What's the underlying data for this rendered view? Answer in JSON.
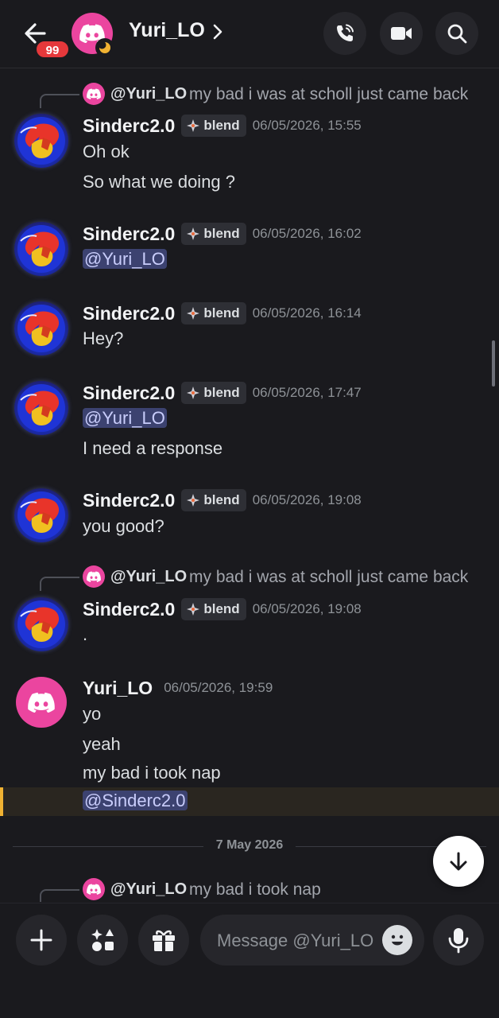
{
  "header": {
    "title": "Yuri_LO",
    "badge_count": "99",
    "back_icon": "arrow-left-icon",
    "actions": [
      "phone-call-icon",
      "video-camera-icon",
      "search-icon"
    ]
  },
  "messages": [
    {
      "reply": {
        "name": "@Yuri_LO",
        "text": "my bad i was at scholl just came back"
      },
      "author": "Sinderc2.0",
      "tag": "blend",
      "time": "06/05/2026, 15:55",
      "lines": [
        "Oh ok",
        "So what we doing ?"
      ]
    },
    {
      "author": "Sinderc2.0",
      "tag": "blend",
      "time": "06/05/2026, 16:02",
      "mention": "@Yuri_LO"
    },
    {
      "author": "Sinderc2.0",
      "tag": "blend",
      "time": "06/05/2026, 16:14",
      "lines": [
        "Hey?"
      ]
    },
    {
      "author": "Sinderc2.0",
      "tag": "blend",
      "time": "06/05/2026, 17:47",
      "mention": "@Yuri_LO",
      "lines": [
        "I need a response"
      ]
    },
    {
      "author": "Sinderc2.0",
      "tag": "blend",
      "time": "06/05/2026, 19:08",
      "lines": [
        "you good?"
      ]
    },
    {
      "reply": {
        "name": "@Yuri_LO",
        "text": "my bad i was at scholl just came back"
      },
      "author": "Sinderc2.0",
      "tag": "blend",
      "time": "06/05/2026, 19:08",
      "lines": [
        "."
      ]
    },
    {
      "author": "Yuri_LO",
      "time": "06/05/2026, 19:59",
      "lines": [
        "yo",
        "yeah",
        "my bad i took nap"
      ],
      "mention": "@Sinderc2.0"
    }
  ],
  "date_divider": "7 May 2026",
  "bottom_reply": {
    "name": "@Yuri_LO",
    "text": "my bad i took nap"
  },
  "composer": {
    "placeholder": "Message @Yuri_LO",
    "buttons": [
      "plus-icon",
      "apps-icon",
      "gift-icon",
      "emoji-icon",
      "microphone-icon"
    ]
  },
  "colors": {
    "background": "#1a1a1e",
    "discord_pink": "#eb459f",
    "badge_red": "#e5383b",
    "mention_bg": "#3c4270",
    "highlight_bar": "#f0b232"
  }
}
